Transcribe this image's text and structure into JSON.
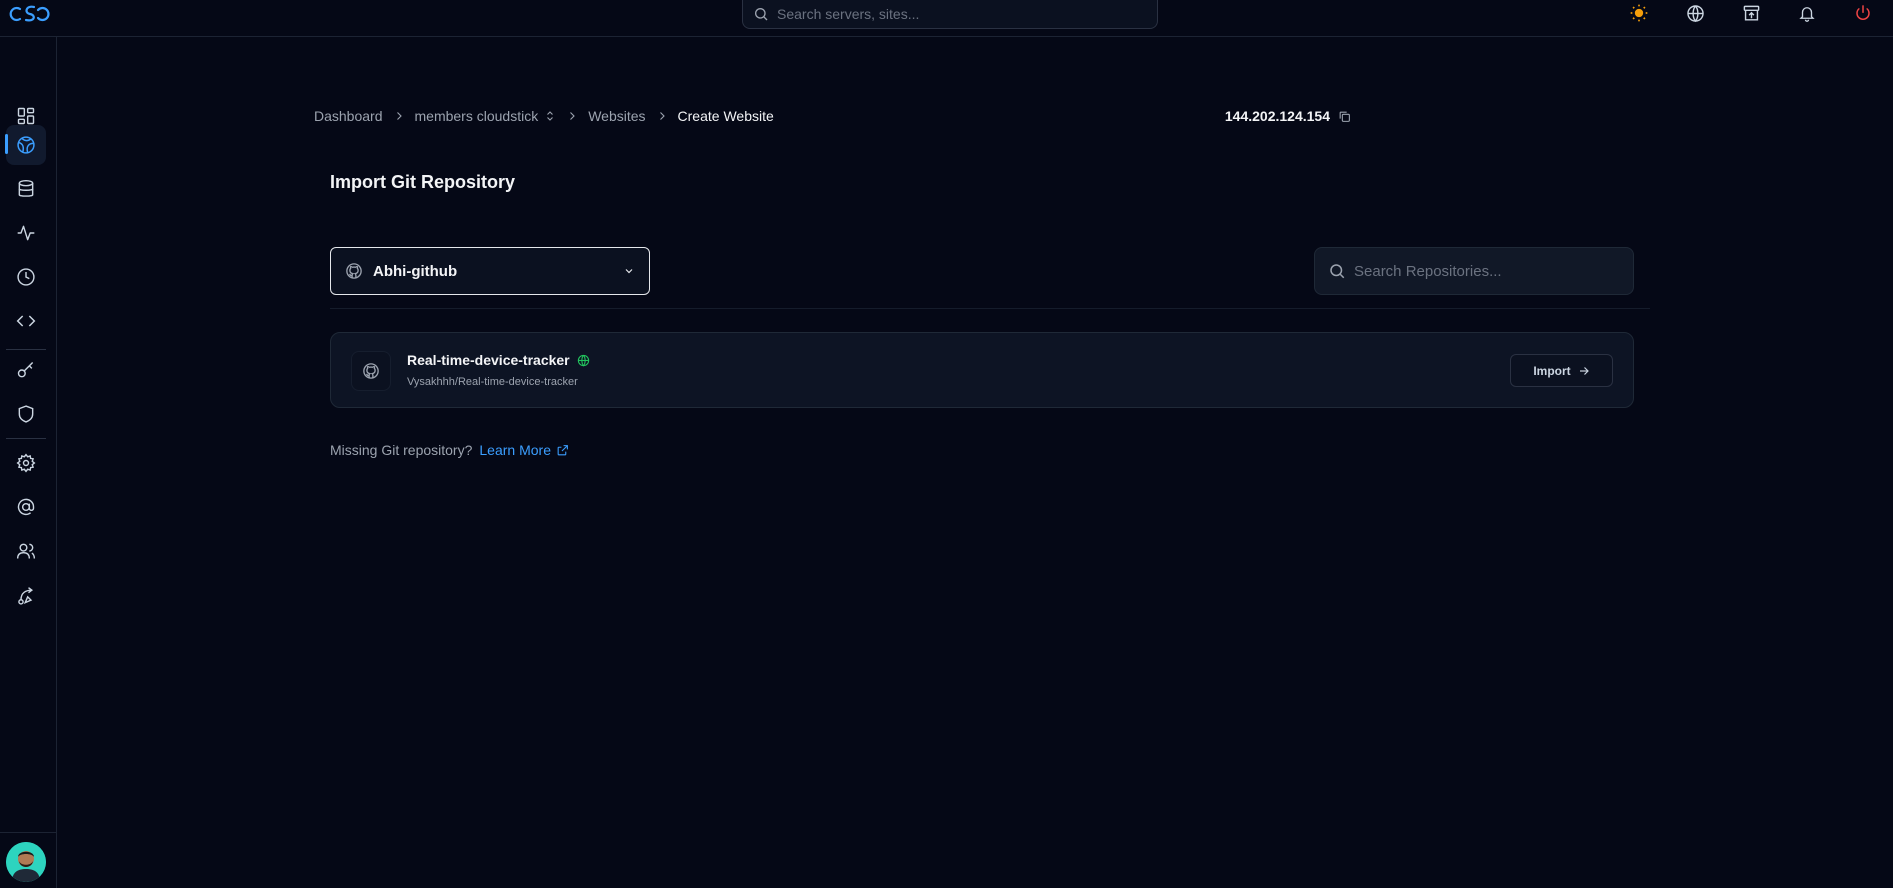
{
  "topbar": {
    "logo_text": "cS",
    "search_placeholder": "Search servers, sites...",
    "icons": [
      "sun-icon",
      "globe-icon",
      "archive-icon",
      "bell-icon",
      "power-icon"
    ]
  },
  "sidebar": {
    "items": [
      {
        "icon": "dashboard-grid-icon",
        "active": false
      },
      {
        "icon": "websites-icon",
        "active": true
      },
      {
        "icon": "database-icon",
        "active": false
      },
      {
        "icon": "activity-icon",
        "active": false
      },
      {
        "icon": "clock-icon",
        "active": false
      },
      {
        "icon": "code-icon",
        "active": false
      },
      {
        "icon": "key-icon",
        "active": false
      },
      {
        "icon": "shield-icon",
        "active": false
      },
      {
        "icon": "settings-icon",
        "active": false
      },
      {
        "icon": "at-sign-icon",
        "active": false
      },
      {
        "icon": "users-icon",
        "active": false
      },
      {
        "icon": "route-icon",
        "active": false
      }
    ]
  },
  "breadcrumb": {
    "items": [
      "Dashboard",
      "members cloudstick",
      "Websites",
      "Create Website"
    ]
  },
  "server_ip": "144.202.124.154",
  "page_title": "Import Git Repository",
  "account_select": {
    "selected": "Abhi-github"
  },
  "repo_search": {
    "placeholder": "Search Repositories..."
  },
  "repositories": [
    {
      "name": "Real-time-device-tracker",
      "path": "Vysakhhh/Real-time-device-tracker",
      "visibility_icon": "globe-icon",
      "action_label": "Import"
    }
  ],
  "footer": {
    "missing_text": "Missing Git repository?",
    "learn_more": "Learn More"
  },
  "colors": {
    "background": "#050816",
    "accent": "#3b9eff",
    "power": "#ef4444",
    "sun": "#f59e0b",
    "public_badge": "#22c55e"
  }
}
